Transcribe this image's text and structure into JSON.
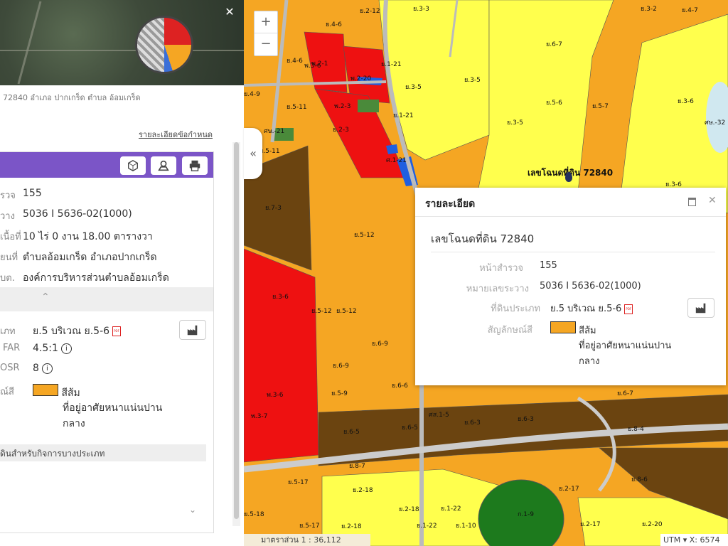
{
  "left_panel": {
    "address": "72840 อำเภอ ปากเกร็ด ตำบล อ้อมเกร็ด",
    "rule_link": "รายละเอียดข้อกำหนด",
    "rows": {
      "survey": {
        "label": "รวจ",
        "value": "155"
      },
      "map_sheet": {
        "label": "วาง",
        "value": "5036 I 5636-02(1000)"
      },
      "area": {
        "label": "เนื้อที่",
        "value": "10 ไร่ 0 งาน 18.00 ตารางวา"
      },
      "location": {
        "label": "ยนที่",
        "value": "ตำบลอ้อมเกร็ด อำเภอปากเกร็ด"
      },
      "authority": {
        "label": "บต.",
        "value": "องค์การบริหารส่วนตำบลอ้อมเกร็ด"
      },
      "land_type": {
        "label": "เภท",
        "value": "ย.5 บริเวณ ย.5-6"
      },
      "far": {
        "label": "FAR",
        "value": "4.5:1"
      },
      "osr": {
        "label": "OSR",
        "value": "8"
      },
      "color": {
        "label": "ณ์สี",
        "value": "สีส้ม",
        "desc_line1": "ที่อยู่อาศัยหนาแน่นปาน",
        "desc_line2": "กลาง"
      }
    },
    "special_bar": "ดินสำหรับกิจการบางประเภท",
    "info_mark": "i",
    "pdf_mark": "PDF"
  },
  "map": {
    "deed_label": "เลขโฉนดที่ดิน 72840",
    "zoom_in": "+",
    "zoom_out": "−",
    "toggle": "«",
    "scale": "มาตราส่วน 1 : 36,112",
    "utm": "UTM ▾  X: 6574",
    "zone_labels": {
      "z01": "ย.2-12",
      "z02": "ย.3-3",
      "z03": "ย.4-6",
      "z04": "ย.4-6",
      "z05": "พ.2-1",
      "z06": "พ.2-20",
      "z07": "ย.1-21",
      "z08": "ย.3-5",
      "z09": "ย.3-5",
      "z10": "ย.5-11",
      "z11": "พ.2-3",
      "z12": "ย.1-21",
      "z13": "ย.5-6",
      "z14": "ย.5-7",
      "z15": "ย.3-6",
      "z16": "ศ.1-21",
      "z17": "ย.4-9",
      "z18": "ย.3-5",
      "z19": "ย.5-11",
      "z20": "ย.2-3",
      "z21": "ศษ.-21",
      "z22": "ย.7-3",
      "z23": "ย.5-12",
      "z24": "ย.3-6",
      "z25": "พ.3-6",
      "z26": "ย.5-12",
      "z27": "ย.5-12",
      "z28": "ย.6-9",
      "z29": "ย.6-9",
      "z30": "ย.5-9",
      "z31": "ย.6-6",
      "z32": "พ.3-6",
      "z33": "พ.3-7",
      "z34": "ย.6-5",
      "z35": "ย.6-5",
      "z36": "ย.6-3",
      "z37": "ย.6-3",
      "z38": "ย.8-7",
      "z39": "ย.5-17",
      "z40": "ย.2-18",
      "z41": "ย.2-18",
      "z42": "ย.2-18",
      "z43": "ย.1-10",
      "z44": "ก.1-9",
      "z45": "ย.2-17",
      "z46": "ย.2-17",
      "z47": "ย.2-20",
      "z48": "ย.6-7",
      "z49": "ย.8-4",
      "z50": "ย.8-6",
      "z51": "ย.5-18",
      "z52": "ย.5-17",
      "z53": "ย.1-22",
      "z54": "ย.1-22",
      "z55": "ย.3-2",
      "z56": "ย.4-7",
      "z57": "ศษ.-32",
      "z58": "ย.6-7",
      "z59": "ศส.1-5",
      "z60": "ย.3-6"
    }
  },
  "popup": {
    "title": "รายละเอียด",
    "deed": "เลขโฉนดที่ดิน 72840",
    "survey_label": "หน้าสำรวจ",
    "survey_value": "155",
    "map_label": "หมายเลขระวาง",
    "map_value": "5036 I 5636-02(1000)",
    "type_label": "ที่ดินประเภท",
    "type_value": "ย.5 บริเวณ ย.5-6",
    "color_label": "สัญลักษณ์สี",
    "color_value": "สีส้ม",
    "color_desc1": "ที่อยู่อาศัยหนาแน่นปาน",
    "color_desc2": "กลาง",
    "close": "✕",
    "pdf_mark": "PDF"
  },
  "colors": {
    "orange": "#f5a623",
    "yellow": "#ffff4d",
    "red": "#ee1111",
    "brown": "#6b4410",
    "blue": "#1f5fe0",
    "green": "#1d7a1d",
    "purple": "#7b55c7"
  }
}
